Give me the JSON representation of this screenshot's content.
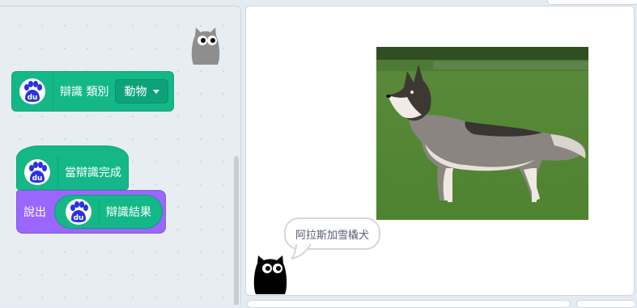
{
  "code_area": {
    "block_recognize": {
      "label": "辯識 類別",
      "dropdown_value": "動物",
      "logo_text": "du"
    },
    "block_when_done": {
      "label": "當辯識完成",
      "logo_text": "du"
    },
    "block_say": {
      "label": "說出",
      "reporter_label": "辯識結果",
      "logo_text": "du"
    }
  },
  "stage": {
    "speech_text": "阿拉斯加雪橇犬"
  },
  "colors": {
    "extension_green": "#14b888",
    "looks_purple": "#9966ff",
    "baidu_blue": "#2932e1"
  }
}
